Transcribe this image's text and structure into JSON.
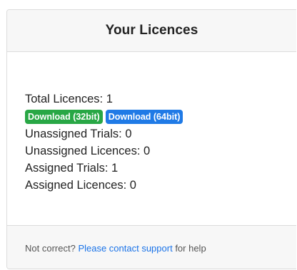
{
  "card": {
    "title": "Your Licences",
    "total_licences": "Total Licences: 1",
    "downloads": {
      "download_32bit": "Download (32bit)",
      "download_64bit": "Download (64bit)"
    },
    "unassigned_trials": "Unassigned Trials: 0",
    "unassigned_licences": "Unassigned Licences: 0",
    "assigned_trials": "Assigned Trials: 1",
    "assigned_licences": "Assigned Licences: 0"
  },
  "footer": {
    "prefix": "Not correct?",
    "link": "Please contact support",
    "suffix": "for help"
  },
  "colors": {
    "download_32bit_badge": "#28a745",
    "download_64bit_badge": "#1f7ae6",
    "link": "#1a73e8",
    "header_background": "#f7f7f7"
  }
}
